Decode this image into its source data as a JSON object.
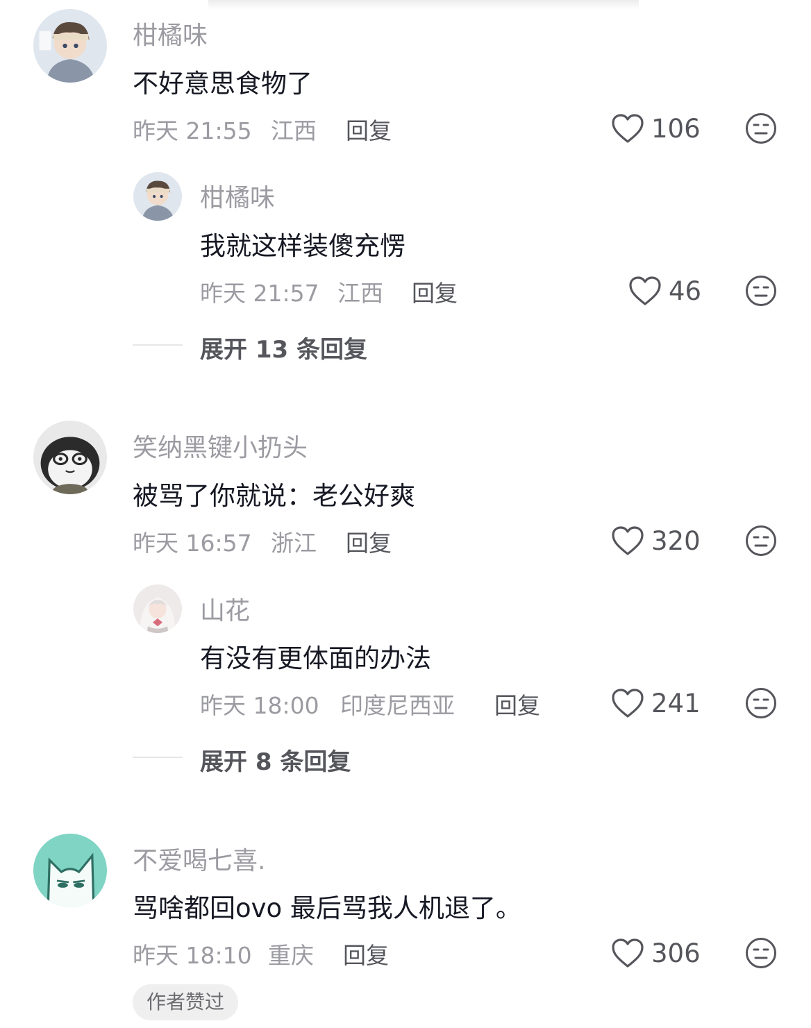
{
  "comments": [
    {
      "username": "柑橘味",
      "text": "不好意思食物了",
      "time": "昨天 21:55",
      "location": "江西",
      "reply_label": "回复",
      "likes": "106",
      "replies": [
        {
          "username": "柑橘味",
          "text": "我就这样装傻充愣",
          "time": "昨天 21:57",
          "location": "江西",
          "reply_label": "回复",
          "likes": "46"
        }
      ],
      "expand_label": "展开 13 条回复"
    },
    {
      "username": "笑纳黑键小扔头",
      "text": "被骂了你就说：老公好爽",
      "time": "昨天 16:57",
      "location": "浙江",
      "reply_label": "回复",
      "likes": "320",
      "replies": [
        {
          "username": "山花",
          "text": "有没有更体面的办法",
          "time": "昨天 18:00",
          "location": "印度尼西亚",
          "reply_label": "回复",
          "likes": "241"
        }
      ],
      "expand_label": "展开 8 条回复"
    },
    {
      "username": "不爱喝七喜.",
      "text": "骂啥都回ovo 最后骂我人机退了。",
      "time": "昨天 18:10",
      "location": "重庆",
      "reply_label": "回复",
      "likes": "306",
      "badge": "作者赞过"
    }
  ],
  "icons": {
    "like": "heart-outline-icon",
    "dislike": "neutral-face-icon"
  },
  "colors": {
    "text_primary": "#161823",
    "text_secondary": "#9b9ba2",
    "text_action": "#55565c",
    "badge_bg": "#efefef"
  }
}
